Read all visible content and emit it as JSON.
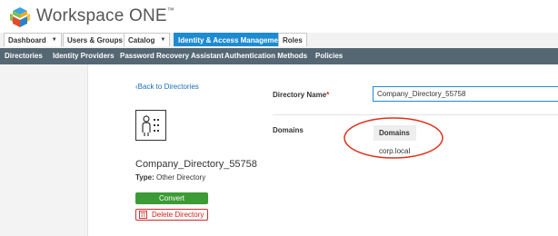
{
  "app": {
    "title": "Workspace ONE",
    "trademark": "™"
  },
  "tabs": [
    {
      "label": "Dashboard",
      "dropdown": true
    },
    {
      "label": "Users & Groups",
      "dropdown": false
    },
    {
      "label": "Catalog",
      "dropdown": true
    },
    {
      "label": "Identity & Access Management",
      "dropdown": false,
      "active": true
    },
    {
      "label": "Roles",
      "dropdown": false
    }
  ],
  "subnav": [
    {
      "label": "Directories"
    },
    {
      "label": "Identity Providers"
    },
    {
      "label": "Password Recovery Assistant"
    },
    {
      "label": "Authentication Methods"
    },
    {
      "label": "Policies"
    }
  ],
  "left_panel": {
    "back_link": "Back to Directories",
    "directory_name": "Company_Directory_55758",
    "type_label": "Type:",
    "type_value": "Other Directory",
    "convert_button": "Convert",
    "delete_button": "Delete Directory"
  },
  "form": {
    "directory_name_label": "Directory Name",
    "required_mark": "*",
    "directory_name_value": "Company_Directory_55758",
    "domains_label": "Domains",
    "domains_table": {
      "header": "Domains",
      "rows": [
        "corp.local"
      ]
    }
  },
  "colors": {
    "accent": "#1d8bd1",
    "subnav_bg": "#546773",
    "convert_green": "#3c9b35",
    "delete_red": "#d12b2b",
    "annotation_red": "#e0301e"
  },
  "icons": {
    "logo": "workspace-one-logo-icon",
    "directory": "directory-user-icon",
    "trash": "trash-icon",
    "back": "chevron-left-icon"
  }
}
